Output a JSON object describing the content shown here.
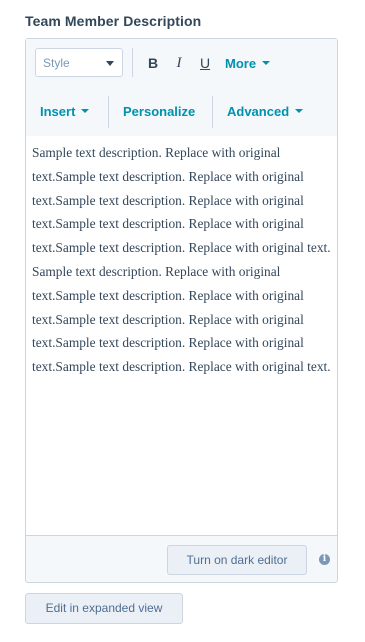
{
  "field": {
    "label": "Team Member Description"
  },
  "toolbar": {
    "style_select": "Style",
    "bold": "B",
    "italic": "I",
    "underline": "U",
    "more": "More",
    "insert": "Insert",
    "personalize": "Personalize",
    "advanced": "Advanced"
  },
  "editor": {
    "content": "Sample text description. Replace with original text.Sample text description. Replace with original text.Sample text description. Replace with original text.Sample text description. Replace with original text.Sample text description. Replace with original text. Sample text description. Replace with original text.Sample text description. Replace with original text.Sample text description. Replace with original text.Sample text description. Replace with original text.Sample text description. Replace with original text."
  },
  "footer": {
    "dark_editor_button": "Turn on dark editor",
    "info_icon": "i"
  },
  "actions": {
    "expand_button": "Edit in expanded view"
  },
  "colors": {
    "accent": "#0091ae",
    "text": "#33475b",
    "border": "#cbd6e2",
    "toolbar_bg": "#f5f8fa",
    "button_bg": "#eaf0f6",
    "spellcheck": "#e0413b"
  },
  "icons": {
    "style_caret": "chevron-down-icon",
    "link_caret": "caret-down-icon",
    "info": "info-icon"
  }
}
